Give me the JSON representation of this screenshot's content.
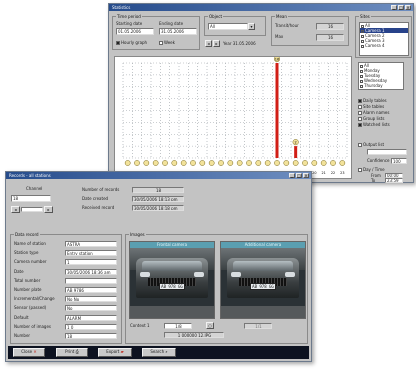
{
  "stats": {
    "title": "Statistics",
    "timeperiod": {
      "title": "Time period",
      "from_label": "Starting date",
      "to_label": "Ending date",
      "from_value": "01.05.2006",
      "to_value": "31.05.2006",
      "opt1": "Hourly graph",
      "opt2": "Week"
    },
    "object": {
      "title": "Object",
      "value": "All"
    },
    "range_label": "Year 31.05.2006",
    "mean": {
      "title": "Mean",
      "row1": "Transit/hour",
      "row2": "Max",
      "val1": "16",
      "val2": "16"
    },
    "sites": {
      "title": "Sites",
      "items": [
        "All",
        "Camera 1",
        "Camera 2",
        "Camera 3",
        "Camera 4"
      ],
      "selected": 1
    },
    "days": {
      "items": [
        "All",
        "Monday",
        "Tuesday",
        "Wednesday",
        "Thursday"
      ]
    },
    "options": [
      "Daily tables",
      "Site tables",
      "Alarm names",
      "Group lists",
      "Watched lists"
    ],
    "side": {
      "chk1": "Output list",
      "lbl2": "Confidence",
      "val2": "100",
      "chk3": "Day / Time",
      "from_lbl": "From",
      "to_lbl": "To",
      "from_val": "00:00",
      "to_val": "23:59"
    },
    "axis_labels": [
      "0",
      "1",
      "2",
      "3",
      "4",
      "5",
      "6",
      "7",
      "8",
      "9",
      "10",
      "11",
      "12",
      "13",
      "14",
      "15",
      "16",
      "17",
      "18",
      "19",
      "20",
      "21",
      "22",
      "23"
    ],
    "chart_data": {
      "type": "bar",
      "categories": [
        "0",
        "1",
        "2",
        "3",
        "4",
        "5",
        "6",
        "7",
        "8",
        "9",
        "10",
        "11",
        "12",
        "13",
        "14",
        "15",
        "16",
        "17",
        "18",
        "19",
        "20",
        "21",
        "22",
        "23"
      ],
      "values": [
        0,
        0,
        0,
        0,
        0,
        0,
        0,
        0,
        0,
        0,
        0,
        0,
        0,
        0,
        0,
        0,
        16,
        0,
        2,
        0,
        0,
        0,
        0,
        0
      ],
      "xlabel": "",
      "ylabel": ""
    },
    "bar_labels": {
      "tall": "16",
      "small": "2"
    }
  },
  "records": {
    "title": "Records - all stations",
    "search_label": "Channel",
    "search_value": "18",
    "num_records_label": "Number of records",
    "num_records": "18",
    "created_label": "Date created",
    "created": "30/05/2006 18:13 pm",
    "received_label": "Received record",
    "received": "30/05/2006 18:18 pm",
    "data_title": "Data record",
    "rows": [
      {
        "label": "Name of station",
        "value": "ASTRA"
      },
      {
        "label": "Station type",
        "value": "Entry station"
      },
      {
        "label": "Camera number",
        "value": "1"
      },
      {
        "label": "Date",
        "value": "30/05/2006 18:36 am"
      },
      {
        "label": "Total number",
        "value": ""
      },
      {
        "label": "Number plate",
        "value": "AB 9786"
      },
      {
        "label": "Incremental/Change",
        "value": "No   No"
      },
      {
        "label": "Sensor (passed)",
        "value": "No"
      },
      {
        "label": "Default",
        "value": "ALARM"
      },
      {
        "label": "Number of images",
        "value": "1   0"
      },
      {
        "label": "Number",
        "value": "18"
      }
    ],
    "images_title": "Images",
    "cam1_label": "Frontal camera",
    "cam2_label": "Additional camera",
    "plate_text": "AB 978 GG",
    "camera_label": "Context 1",
    "ratio1": "1/8",
    "ratio2": "1/1",
    "file_name": "1 000000 12.JPG",
    "buttons": {
      "close": "Close",
      "print": "Print",
      "export": "Export",
      "search": "Search"
    }
  }
}
